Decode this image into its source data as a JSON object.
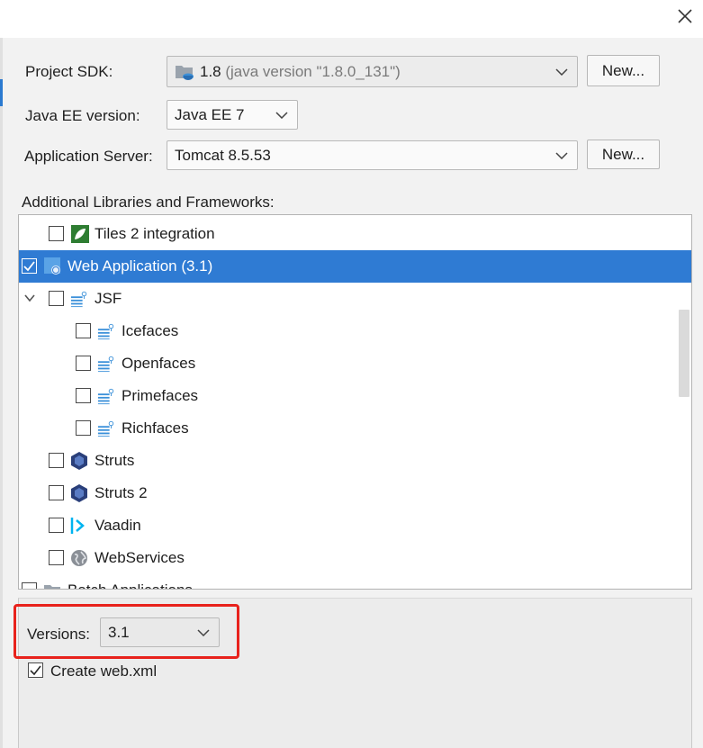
{
  "window": {
    "close_icon": "close-icon"
  },
  "form": {
    "project_sdk": {
      "label": "Project SDK:",
      "selected_version": "1.8",
      "selected_detail": " (java version \"1.8.0_131\")",
      "button_label": "New..."
    },
    "java_ee": {
      "label": "Java EE version:",
      "value": "Java EE 7"
    },
    "app_server": {
      "label": "Application Server:",
      "value": "Tomcat 8.5.53",
      "button_label": "New..."
    }
  },
  "libraries": {
    "heading": "Additional Libraries and Frameworks:",
    "items": [
      {
        "label": "Tiles 2 integration",
        "icon": "tiles-leaf-icon",
        "checked": false,
        "level": 1
      },
      {
        "label": "Web Application (3.1)",
        "icon": "web-application-icon",
        "checked": true,
        "level": 0,
        "selected": true
      },
      {
        "label": "JSF",
        "icon": "jsf-icon",
        "checked": false,
        "level": 1,
        "expanded": true
      },
      {
        "label": "Icefaces",
        "icon": "jsf-icon",
        "checked": false,
        "level": 2
      },
      {
        "label": "Openfaces",
        "icon": "jsf-icon",
        "checked": false,
        "level": 2
      },
      {
        "label": "Primefaces",
        "icon": "jsf-icon",
        "checked": false,
        "level": 2
      },
      {
        "label": "Richfaces",
        "icon": "jsf-icon",
        "checked": false,
        "level": 2
      },
      {
        "label": "Struts",
        "icon": "struts-icon",
        "checked": false,
        "level": 1
      },
      {
        "label": "Struts 2",
        "icon": "struts-icon",
        "checked": false,
        "level": 1
      },
      {
        "label": "Vaadin",
        "icon": "vaadin-icon",
        "checked": false,
        "level": 1
      },
      {
        "label": "WebServices",
        "icon": "webservices-globe-icon",
        "checked": false,
        "level": 1
      },
      {
        "label": "Batch Applications",
        "icon": "folder-icon",
        "checked": false,
        "level": 0
      }
    ]
  },
  "details": {
    "versions_label": "Versions:",
    "versions_value": "3.1",
    "create_webxml_label": "Create web.xml",
    "create_webxml_checked": true
  },
  "colors": {
    "selection": "#2f7bd3",
    "highlight_box": "#e8221c"
  }
}
